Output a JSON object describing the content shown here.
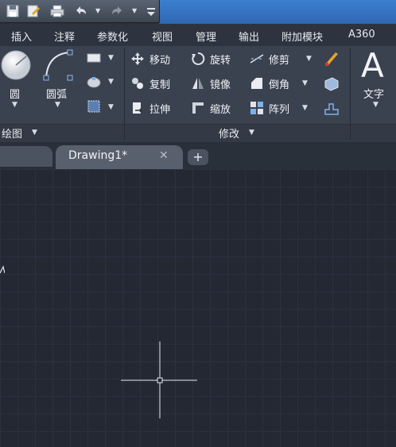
{
  "quick_access": {
    "icons": [
      "save-icon",
      "saveas-icon",
      "print-icon",
      "undo-icon",
      "redo-icon",
      "customize-icon"
    ]
  },
  "menu": {
    "items": [
      "插入",
      "注释",
      "参数化",
      "视图",
      "管理",
      "输出",
      "附加模块",
      "A360"
    ]
  },
  "ribbon": {
    "draw": {
      "circle_label": "圆",
      "arc_label": "圆弧",
      "panel_title": "绘图"
    },
    "modify": {
      "move": "移动",
      "rotate": "旋转",
      "trim": "修剪",
      "copy": "复制",
      "mirror": "镜像",
      "fillet": "倒角",
      "stretch": "拉伸",
      "scale": "缩放",
      "array": "阵列",
      "panel_title": "修改"
    },
    "annotation": {
      "text_label": "文字",
      "text_glyph": "A"
    },
    "colors": {
      "accent": "#3b7fd0",
      "ribbon_bg": "#3a4250",
      "canvas_bg": "#232833"
    }
  },
  "tabs": {
    "drawing_tab": "Drawing1*",
    "close_glyph": "✕",
    "add_glyph": "+"
  }
}
